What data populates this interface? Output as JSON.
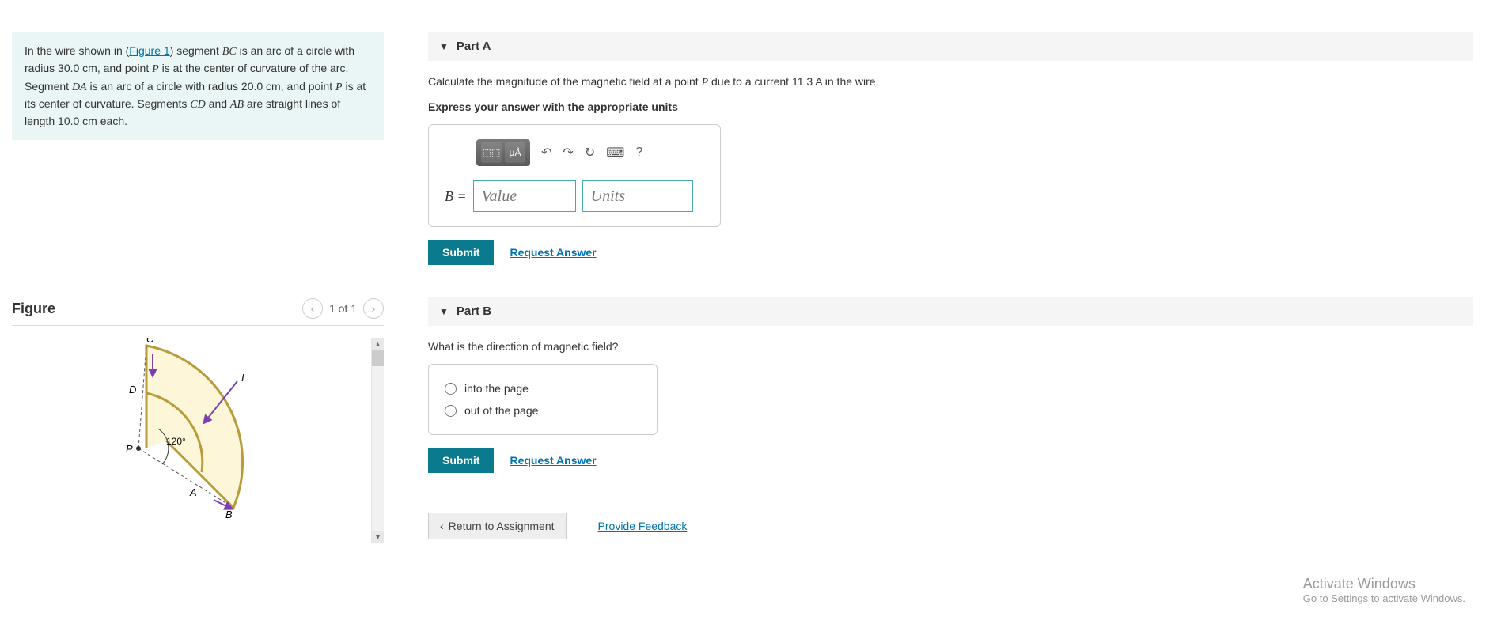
{
  "problem": {
    "text_prefix": "In the wire shown in (",
    "figure_link": "Figure 1",
    "text_mid1": ") segment ",
    "seg_bc": "BC",
    "text_mid2": " is an arc of a circle with radius ",
    "radius_bc": "30.0 cm",
    "text_mid3": ", and point ",
    "point_p1": "P",
    "text_mid4": " is at the center of curvature of the arc. Segment ",
    "seg_da": "DA",
    "text_mid5": " is an arc of a circle with radius ",
    "radius_da": "20.0 cm",
    "text_mid6": ", and point ",
    "point_p2": "P",
    "text_mid7": " is at its center of curvature. Segments ",
    "seg_cd": "CD",
    "text_and": " and ",
    "seg_ab": "AB",
    "text_tail": " are straight lines of length ",
    "line_len": "10.0 cm",
    "text_end": " each."
  },
  "figure": {
    "title": "Figure",
    "nav_label": "1 of 1",
    "labels": {
      "C": "C",
      "D": "D",
      "P": "P",
      "A": "A",
      "B": "B",
      "I": "I",
      "angle": "120°"
    }
  },
  "partA": {
    "title": "Part A",
    "q_prefix": "Calculate the magnitude of the magnetic field at a point ",
    "q_point": "P",
    "q_mid": " due to a current ",
    "q_current": "11.3  A",
    "q_tail": " in the wire.",
    "instruction": "Express your answer with the appropriate units",
    "toolbar": {
      "templates": "⬚⬚",
      "units": "μÅ",
      "undo": "↶",
      "redo": "↷",
      "reset": "↻",
      "keyboard": "⌨",
      "help": "?"
    },
    "var_label": "B =",
    "value_placeholder": "Value",
    "units_placeholder": "Units",
    "submit": "Submit",
    "request": "Request Answer"
  },
  "partB": {
    "title": "Part B",
    "question": "What is the direction of magnetic field?",
    "opt1": "into the page",
    "opt2": "out of the page",
    "submit": "Submit",
    "request": "Request Answer"
  },
  "footer": {
    "return": "Return to Assignment",
    "feedback": "Provide Feedback"
  },
  "watermark": {
    "line1": "Activate Windows",
    "line2": "Go to Settings to activate Windows."
  }
}
